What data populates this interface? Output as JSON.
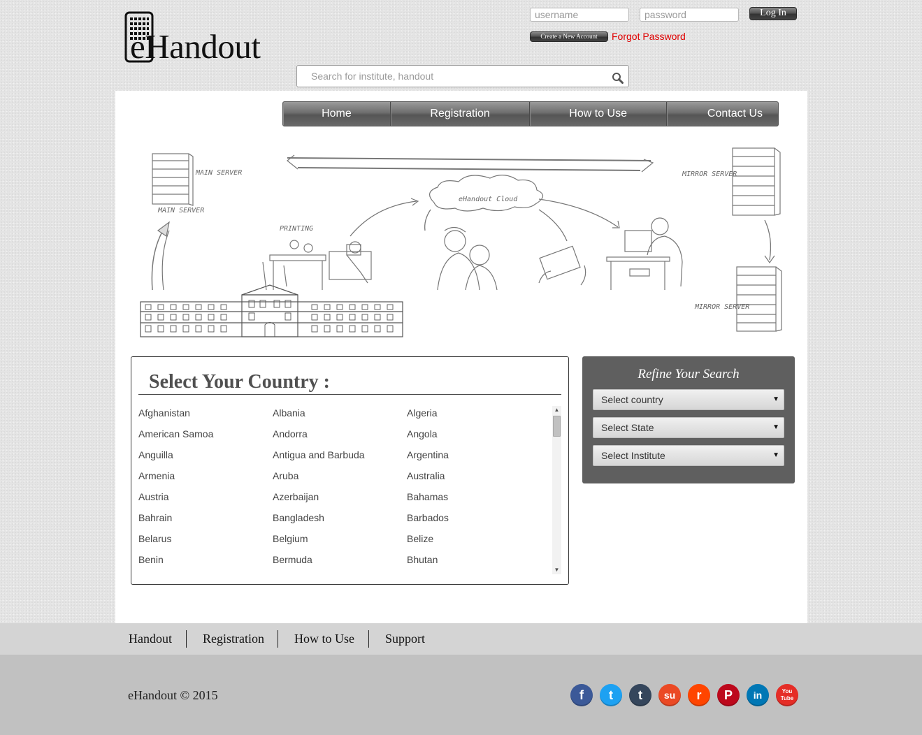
{
  "logo": {
    "text": "Handout",
    "e": "e"
  },
  "login": {
    "username_placeholder": "username",
    "password_placeholder": "password",
    "login_label": "Log In",
    "create_account_label": "Create a New Account",
    "forgot_password_label": "Forgot Password"
  },
  "search": {
    "placeholder": "Search for institute, handout"
  },
  "nav": {
    "items": [
      "Home",
      "Registration",
      "How to Use",
      "Contact Us"
    ]
  },
  "illustration": {
    "labels": {
      "main_server_1": "MAIN SERVER",
      "main_server_2": "MAIN SERVER",
      "printing": "PRINTING",
      "cloud": "eHandout Cloud",
      "mirror_server_1": "MIRROR SERVER",
      "mirror_server_2": "MIRROR SERVER"
    }
  },
  "country_section": {
    "title": "Select Your Country :",
    "countries": [
      "Afghanistan",
      "Albania",
      "Algeria",
      "American Samoa",
      "Andorra",
      "Angola",
      "Anguilla",
      "Antigua and Barbuda",
      "Argentina",
      "Armenia",
      "Aruba",
      "Australia",
      "Austria",
      "Azerbaijan",
      "Bahamas",
      "Bahrain",
      "Bangladesh",
      "Barbados",
      "Belarus",
      "Belgium",
      "Belize",
      "Benin",
      "Bermuda",
      "Bhutan"
    ]
  },
  "refine": {
    "title": "Refine Your Search",
    "country_select": "Select country",
    "state_select": "Select State",
    "institute_select": "Select Institute"
  },
  "footer": {
    "links": [
      "Handout",
      "Registration",
      "How to Use",
      "Support"
    ],
    "copyright": "eHandout © 2015",
    "social": [
      {
        "name": "facebook",
        "glyph": "f",
        "color": "#3b5998"
      },
      {
        "name": "twitter",
        "glyph": "t",
        "color": "#1da1f2"
      },
      {
        "name": "tumblr",
        "glyph": "t",
        "color": "#35465c"
      },
      {
        "name": "stumbleupon",
        "glyph": "su",
        "color": "#eb4924"
      },
      {
        "name": "reddit",
        "glyph": "r",
        "color": "#ff4500"
      },
      {
        "name": "pinterest",
        "glyph": "P",
        "color": "#bd081c"
      },
      {
        "name": "linkedin",
        "glyph": "in",
        "color": "#0077b5"
      },
      {
        "name": "youtube",
        "glyph": "You Tube",
        "color": "#e52d27"
      }
    ]
  }
}
